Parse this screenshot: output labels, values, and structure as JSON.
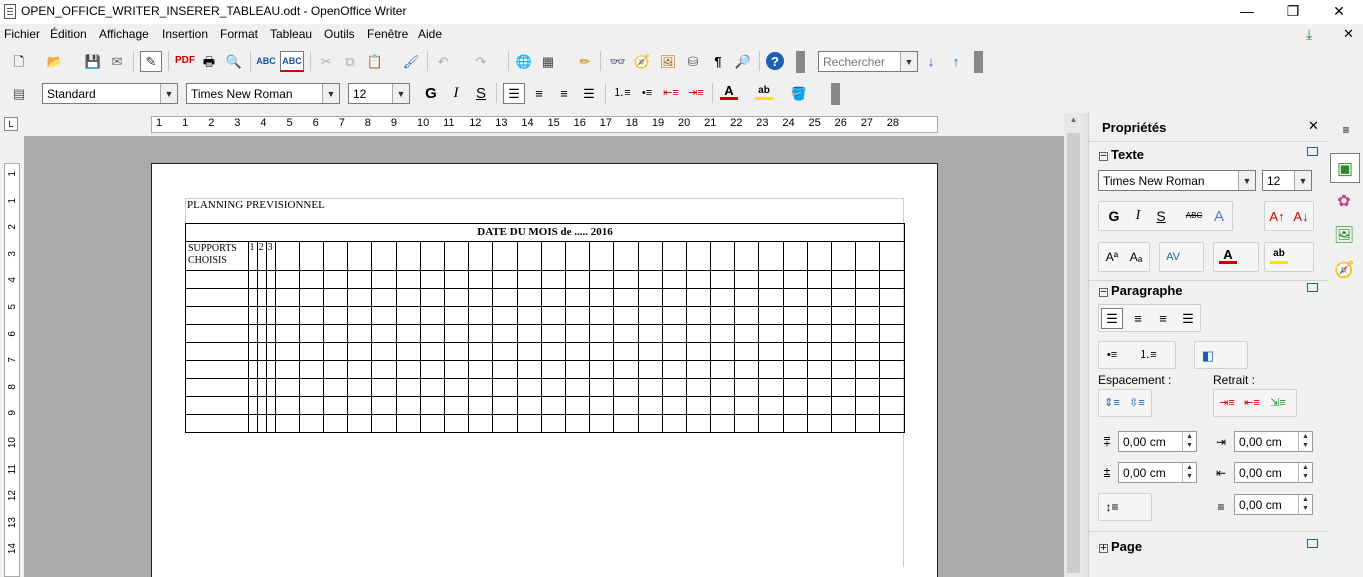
{
  "window": {
    "title": "OPEN_OFFICE_WRITER_INSERER_TABLEAU.odt - OpenOffice Writer",
    "minimize": "—",
    "maximize": "❐",
    "close": "✕"
  },
  "menu": [
    "Fichier",
    "Édition",
    "Affichage",
    "Insertion",
    "Format",
    "Tableau",
    "Outils",
    "Fenêtre",
    "Aide"
  ],
  "toolbar": {
    "search_placeholder": "Rechercher"
  },
  "format_bar": {
    "style": "Standard",
    "font": "Times New Roman",
    "size": "12"
  },
  "ruler": {
    "labels": [
      "1",
      "1",
      "2",
      "3",
      "4",
      "5",
      "6",
      "7",
      "8",
      "9",
      "10",
      "11",
      "12",
      "13",
      "14",
      "15",
      "16",
      "17",
      "18",
      "19",
      "20",
      "21",
      "22",
      "23",
      "24",
      "25",
      "26",
      "27",
      "28"
    ],
    "vlabels": [
      "1",
      "1",
      "2",
      "3",
      "4",
      "5",
      "6",
      "7",
      "8",
      "9",
      "10",
      "11",
      "12",
      "13",
      "14"
    ]
  },
  "document": {
    "heading": "PLANNING PREVISIONNEL",
    "table_title": "DATE DU MOIS  de ..... 2016",
    "first_col_header": "SUPPORTS CHOISIS",
    "day_headers": [
      "1",
      "2",
      "3"
    ]
  },
  "sidebar": {
    "title": "Propriétés",
    "text_section": "Texte",
    "font": "Times New Roman",
    "size": "12",
    "paragraph_section": "Paragraphe",
    "spacing_label": "Espacement :",
    "indent_label": "Retrait :",
    "spacing_values": [
      "0,00 cm",
      "0,00 cm"
    ],
    "indent_values": [
      "0,00 cm",
      "0,00 cm",
      "0,00 cm"
    ],
    "page_section": "Page"
  }
}
